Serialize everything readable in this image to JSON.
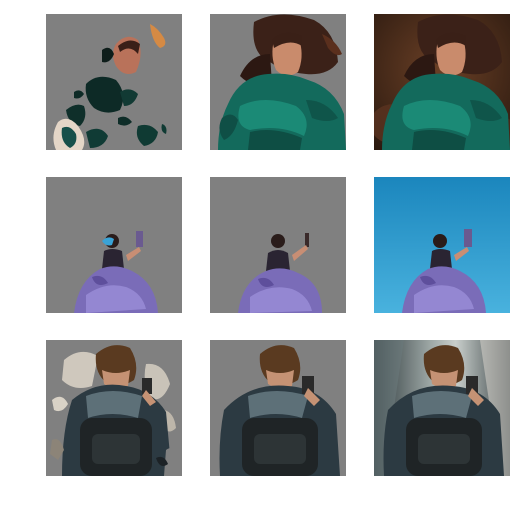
{
  "grid": {
    "rows": 3,
    "columns": 3,
    "masked_background_color": "#808080",
    "rows_content": [
      {
        "subject": "woman-green-jacket",
        "tiles": [
          {
            "name": "woman-partial-mask",
            "kind": "partial-mask"
          },
          {
            "name": "woman-subject-mask",
            "kind": "subject-mask"
          },
          {
            "name": "woman-original",
            "kind": "original",
            "background_color": "#4a2f1e"
          }
        ]
      },
      {
        "subject": "woman-purple-tulle-dress",
        "tiles": [
          {
            "name": "dress-partial-mask",
            "kind": "partial-mask"
          },
          {
            "name": "dress-subject-mask",
            "kind": "subject-mask"
          },
          {
            "name": "dress-original",
            "kind": "original",
            "background_color": "#2f96c6"
          }
        ]
      },
      {
        "subject": "man-with-backpack",
        "tiles": [
          {
            "name": "backpack-partial-mask",
            "kind": "partial-mask"
          },
          {
            "name": "backpack-subject-mask",
            "kind": "subject-mask"
          },
          {
            "name": "backpack-original",
            "kind": "original",
            "background_color": "#6f7778"
          }
        ]
      }
    ]
  }
}
